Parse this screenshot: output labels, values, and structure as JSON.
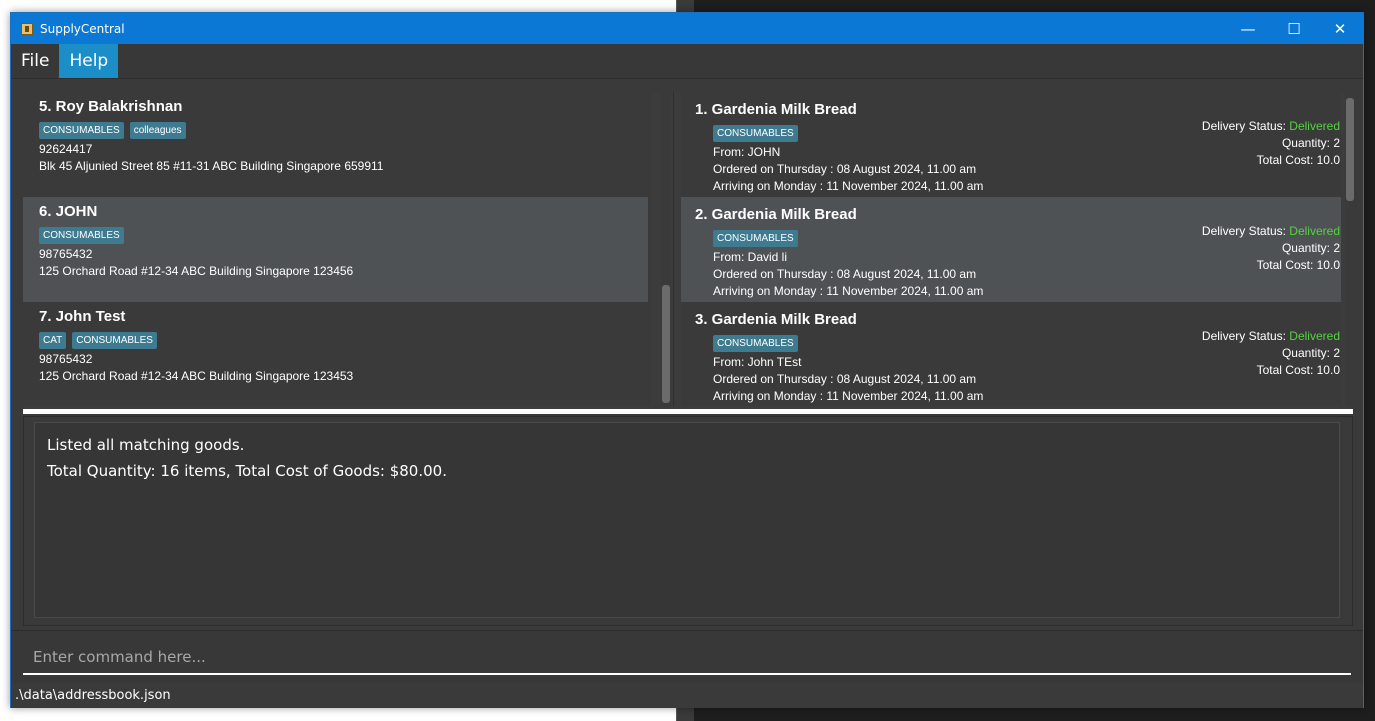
{
  "window": {
    "title": "SupplyCentral"
  },
  "menu": {
    "file": "File",
    "help": "Help"
  },
  "persons": [
    {
      "name": "5. Roy Balakrishnan",
      "tags": [
        "CONSUMABLES",
        "colleagues"
      ],
      "phone": "92624417",
      "address": "Blk 45 Aljunied Street 85 #11-31 ABC Building Singapore 659911"
    },
    {
      "name": "6. JOHN",
      "tags": [
        "CONSUMABLES"
      ],
      "phone": "98765432",
      "address": "125 Orchard Road #12-34 ABC Building Singapore 123456"
    },
    {
      "name": "7. John Test",
      "tags": [
        "CAT",
        "CONSUMABLES"
      ],
      "phone": "98765432",
      "address": "125 Orchard Road #12-34 ABC Building Singapore 123453"
    }
  ],
  "goods": [
    {
      "title": "1. Gardenia Milk Bread",
      "tag": "CONSUMABLES",
      "from": "From: JOHN",
      "ordered": "Ordered on Thursday : 08 August 2024, 11.00 am",
      "arriving": "Arriving on Monday : 11 November 2024, 11.00 am",
      "status_label": "Delivery Status: ",
      "status": "Delivered",
      "quantity": "Quantity: 2",
      "cost": "Total Cost: 10.0"
    },
    {
      "title": "2. Gardenia Milk Bread",
      "tag": "CONSUMABLES",
      "from": "From: David li",
      "ordered": "Ordered on Thursday : 08 August 2024, 11.00 am",
      "arriving": "Arriving on Monday : 11 November 2024, 11.00 am",
      "status_label": "Delivery Status: ",
      "status": "Delivered",
      "quantity": "Quantity: 2",
      "cost": "Total Cost: 10.0"
    },
    {
      "title": "3. Gardenia Milk Bread",
      "tag": "CONSUMABLES",
      "from": "From: John TEst",
      "ordered": "Ordered on Thursday : 08 August 2024, 11.00 am",
      "arriving": "Arriving on Monday : 11 November 2024, 11.00 am",
      "status_label": "Delivery Status: ",
      "status": "Delivered",
      "quantity": "Quantity: 2",
      "cost": "Total Cost: 10.0"
    }
  ],
  "result": {
    "line1": "Listed all matching goods.",
    "line2": "Total Quantity: 16 items, Total Cost of Goods: $80.00."
  },
  "command": {
    "placeholder": "Enter command here..."
  },
  "status": {
    "path": ".\\data\\addressbook.json"
  },
  "colors": {
    "titlebar": "#0a78d4",
    "tag": "#3e7b91",
    "delivered": "#54d340",
    "menu_active": "#1c8ec7"
  }
}
